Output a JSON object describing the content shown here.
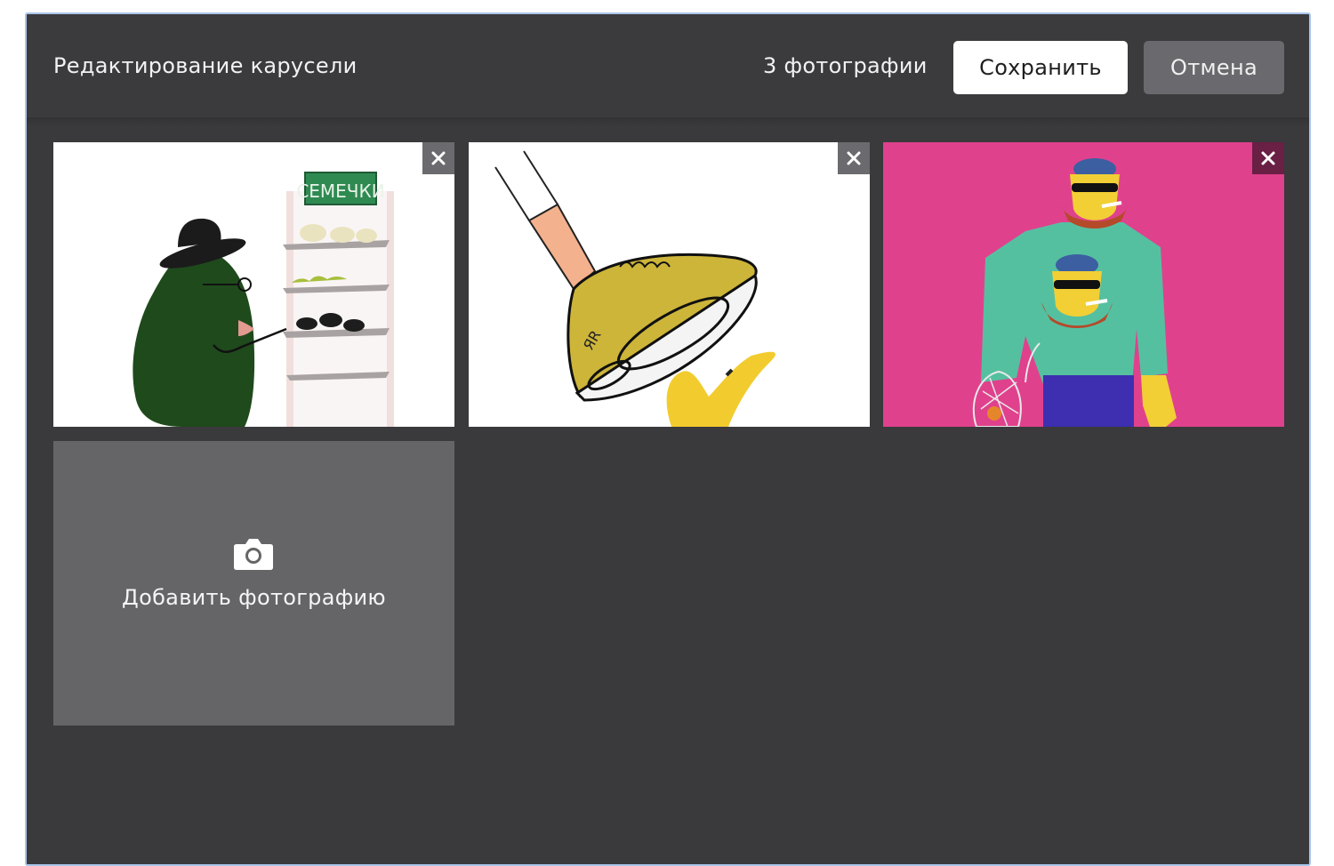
{
  "header": {
    "title": "Редактирование карусели",
    "photo_count": "3 фотографии",
    "save_label": "Сохранить",
    "cancel_label": "Отмена"
  },
  "photos": [
    {
      "sign_text": "СЕМЕЧКИ",
      "background": "#ffffff"
    },
    {
      "sign_text": "ЯR",
      "background": "#ffffff"
    },
    {
      "background": "#e0418d"
    }
  ],
  "add_tile": {
    "label": "Добавить фотографию",
    "icon": "camera-icon"
  },
  "colors": {
    "panel_bg": "#3a393c",
    "frame_border": "#a9c6ea",
    "save_bg": "#ffffff",
    "cancel_bg": "#6a696d",
    "add_tile_bg": "#656467"
  }
}
